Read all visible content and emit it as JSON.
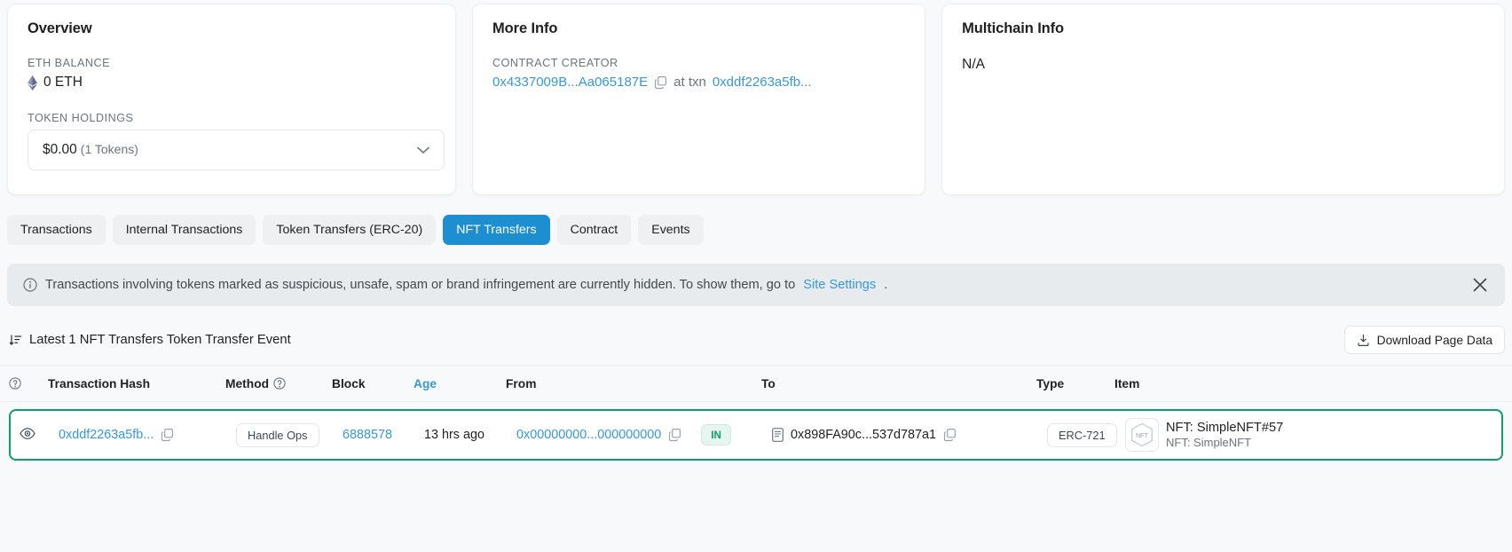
{
  "overview": {
    "title": "Overview",
    "eth_balance_label": "ETH BALANCE",
    "eth_balance_value": "0 ETH",
    "token_holdings_label": "TOKEN HOLDINGS",
    "token_value": "$0.00",
    "token_count": "(1 Tokens)",
    "eth_icon": "ethereum-diamond-icon",
    "chevron_icon": "chevron-down-icon"
  },
  "more_info": {
    "title": "More Info",
    "creator_label": "CONTRACT CREATOR",
    "creator_address": "0x4337009B...Aa065187E",
    "at_txn_label": "at txn",
    "creator_txn": "0xddf2263a5fb...",
    "copy_icon": "copy-icon"
  },
  "multichain": {
    "title": "Multichain Info",
    "value": "N/A"
  },
  "tabs": [
    {
      "label": "Transactions",
      "active": false
    },
    {
      "label": "Internal Transactions",
      "active": false
    },
    {
      "label": "Token Transfers (ERC-20)",
      "active": false
    },
    {
      "label": "NFT Transfers",
      "active": true
    },
    {
      "label": "Contract",
      "active": false
    },
    {
      "label": "Events",
      "active": false
    }
  ],
  "notice": {
    "icon": "info-circle-icon",
    "text_before": "Transactions involving tokens marked as suspicious, unsafe, spam or brand infringement are currently hidden. To show them, go to",
    "link": "Site Settings",
    "text_after": ".",
    "close_icon": "close-icon"
  },
  "list_bar": {
    "sort_icon": "sort-descending-icon",
    "title": "Latest 1 NFT Transfers Token Transfer Event",
    "download_icon": "download-icon",
    "download_label": "Download Page Data"
  },
  "table": {
    "headers": {
      "eye": "",
      "hash": "Transaction Hash",
      "method": "Method",
      "block": "Block",
      "age": "Age",
      "from": "From",
      "to": "To",
      "type": "Type",
      "item": "Item"
    },
    "rows": [
      {
        "eye_icon": "eye-icon",
        "hash": "0xddf2263a5fb...",
        "hash_copy_icon": "copy-icon",
        "method": "Handle Ops",
        "block": "6888578",
        "age": "13 hrs ago",
        "from": "0x00000000...000000000",
        "from_copy_icon": "copy-icon",
        "direction": "IN",
        "to_icon": "contract-icon",
        "to": "0x898FA90c...537d787a1",
        "to_copy_icon": "copy-icon",
        "type": "ERC-721",
        "item_badge": "NFT",
        "item_main": "NFT: SimpleNFT#57",
        "item_sub": "NFT: SimpleNFT"
      }
    ]
  },
  "colors": {
    "link": "#3498db",
    "active_tab": "#1d8fd1",
    "row_highlight": "#0f9d6b",
    "notice_bg": "#e8ebed"
  }
}
